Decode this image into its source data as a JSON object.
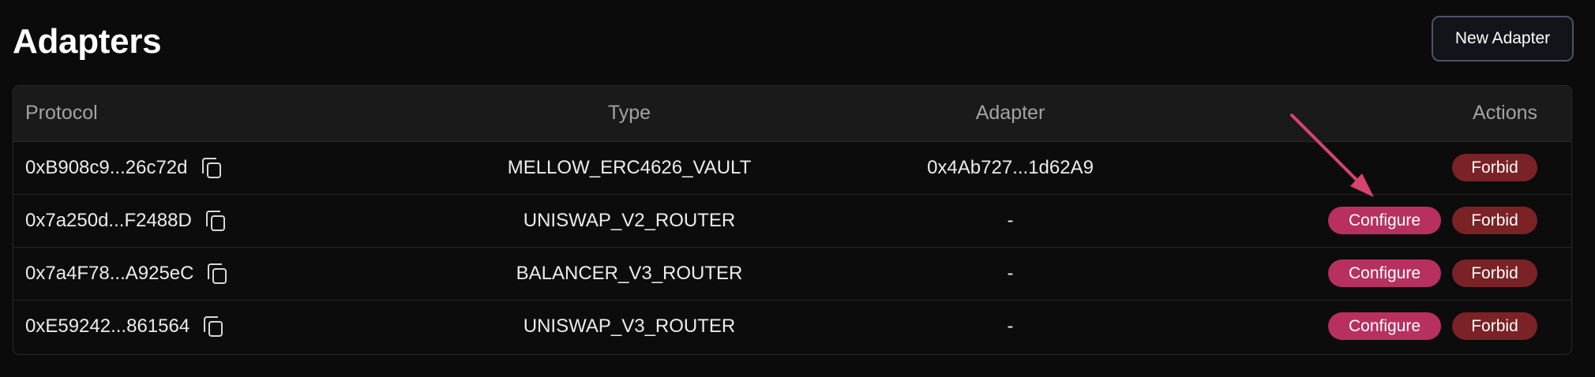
{
  "page": {
    "title": "Adapters"
  },
  "header": {
    "new_adapter_label": "New Adapter"
  },
  "table": {
    "columns": [
      "Protocol",
      "Type",
      "Adapter",
      "Actions"
    ],
    "rows": [
      {
        "protocol": "0xB908c9...26c72d",
        "type": "MELLOW_ERC4626_VAULT",
        "adapter": "0x4Ab727...1d62A9",
        "configure": null,
        "forbid": "Forbid"
      },
      {
        "protocol": "0x7a250d...F2488D",
        "type": "UNISWAP_V2_ROUTER",
        "adapter": "-",
        "configure": "Configure",
        "forbid": "Forbid"
      },
      {
        "protocol": "0x7a4F78...A925eC",
        "type": "BALANCER_V3_ROUTER",
        "adapter": "-",
        "configure": "Configure",
        "forbid": "Forbid"
      },
      {
        "protocol": "0xE59242...861564",
        "type": "UNISWAP_V3_ROUTER",
        "adapter": "-",
        "configure": "Configure",
        "forbid": "Forbid"
      }
    ]
  },
  "icons": {
    "copy": "copy-icon",
    "annotation_arrow": "arrow-annotation"
  },
  "colors": {
    "configure": "#b8305f",
    "forbid": "#7a2226",
    "arrow": "#d9436f"
  }
}
